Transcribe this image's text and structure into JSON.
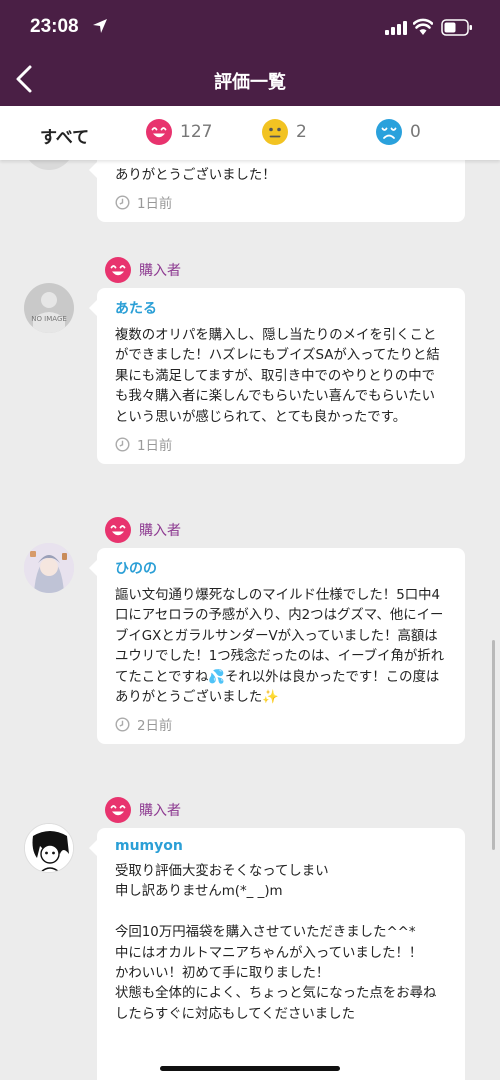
{
  "status": {
    "time": "23:08"
  },
  "nav": {
    "title": "評価一覧"
  },
  "filters": {
    "all": "すべて",
    "good_count": "127",
    "neutral_count": "2",
    "bad_count": "0"
  },
  "colors": {
    "good": "#e8336e",
    "neutral": "#f2c322",
    "bad": "#2aa1dc",
    "header": "#4a1f45",
    "badge": "#8d3a91",
    "username": "#2b9fd6"
  },
  "reviews": [
    {
      "body": "ありがとうございました！",
      "time": "1日前"
    },
    {
      "badge": "購入者",
      "avatar_text": "NO IMAGE",
      "username": "あたる",
      "body": "複数のオリパを購入し、隠し当たりのメイを引くことができました！ハズレにもブイズSAが入ってたりと結果にも満足してますが、取引き中でのやりとりの中でも我々購入者に楽しんでもらいたい喜んでもらいたいという思いが感じられて、とても良かったです。",
      "time": "1日前"
    },
    {
      "badge": "購入者",
      "username": "ひのの",
      "body": "謳い文句通り爆死なしのマイルド仕様でした！5口中4口にアセロラの予感が入り、内2つはグズマ、他にイーブイGXとガラルサンダーVが入っていました！高額はユウリでした！1つ残念だったのは、イーブイ角が折れてたことですね💦それ以外は良かったです！この度はありがとうございました✨",
      "time": "2日前"
    },
    {
      "badge": "購入者",
      "username": "mumyon",
      "body": "受取り評価大変おそくなってしまい\n申し訳ありませんm(*_ _)m\n\n今回10万円福袋を購入させていただきました^^*\n中にはオカルトマニアちゃんが入っていました！！\nかわいい！初めて手に取りました！\n状態も全体的によく、ちょっと気になった点をお尋ねしたらすぐに対応もしてくださいました"
    }
  ]
}
